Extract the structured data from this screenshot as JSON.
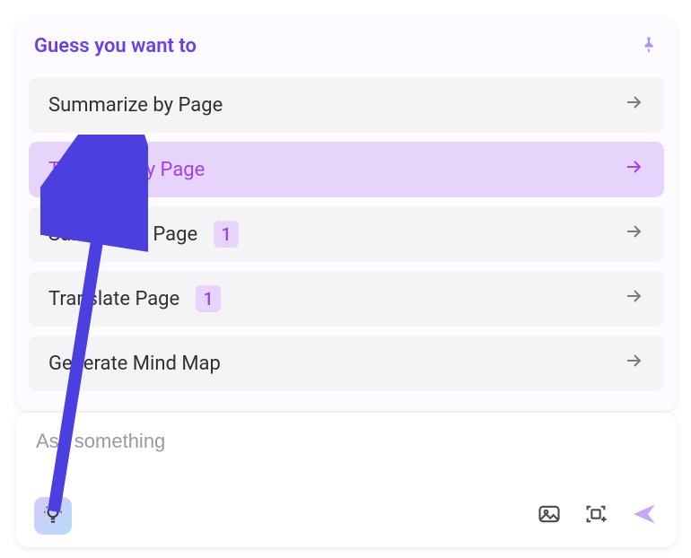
{
  "panel": {
    "title": "Guess you want to"
  },
  "suggestions": [
    {
      "label": "Summarize by Page",
      "badge": null,
      "highlight": false
    },
    {
      "label": "Translate by Page",
      "badge": null,
      "highlight": true
    },
    {
      "label": "Summarize Page",
      "badge": "1",
      "highlight": false
    },
    {
      "label": "Translate Page",
      "badge": "1",
      "highlight": false
    },
    {
      "label": "Generate Mind Map",
      "badge": null,
      "highlight": false
    }
  ],
  "input": {
    "placeholder": "Ask something"
  }
}
